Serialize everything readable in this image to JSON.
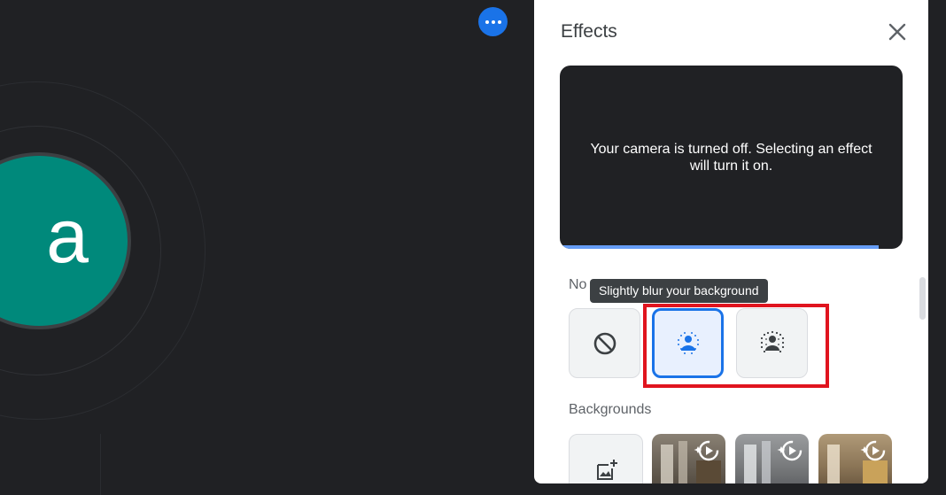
{
  "call": {
    "avatar_letter": "a",
    "avatar_color": "#00897b",
    "more_options_icon": "more-horizontal-icon"
  },
  "effects_panel": {
    "title": "Effects",
    "close_icon": "close-icon",
    "preview_message": "Your camera is turned off. Selecting an effect will turn it on.",
    "blur_section_label": "No",
    "tooltip": "Slightly blur your background",
    "blur_options": [
      {
        "icon": "no-effect-icon",
        "selected": false
      },
      {
        "icon": "slight-blur-icon",
        "selected": true
      },
      {
        "icon": "blur-background-icon",
        "selected": false
      }
    ],
    "backgrounds_label": "Backgrounds",
    "background_tiles": [
      {
        "icon": "add-image-icon"
      },
      {
        "icon": "animated-background-icon"
      },
      {
        "icon": "animated-background-icon"
      },
      {
        "icon": "animated-background-icon"
      }
    ],
    "accent_color": "#1a73e8",
    "highlight_color": "#e0141e"
  }
}
